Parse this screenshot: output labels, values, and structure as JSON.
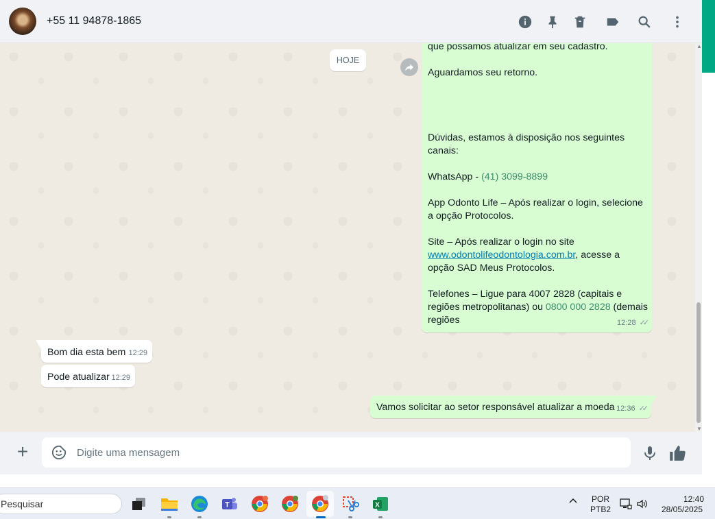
{
  "header": {
    "contact": "+55 11 94878-1865",
    "icons": [
      "info-icon",
      "pin-icon",
      "trash-icon",
      "label-icon",
      "search-icon",
      "menu-icon"
    ]
  },
  "chat": {
    "date_label": "HOJE",
    "big_message": {
      "lines": [
        "que possamos atualizar em seu cadastro.",
        "",
        "Aguardamos seu retorno.",
        "",
        "",
        "",
        "",
        "Dúvidas, estamos à disposição nos seguintes",
        "canais:",
        "",
        "WhatsApp - ",
        "",
        "App Odonto Life – Após realizar o login, selecione",
        "a opção Protocolos.",
        "",
        "Site – Após realizar o login no site",
        ", acesse a",
        "opção SAD Meus Protocolos.",
        "",
        "Telefones – Ligue para 4007 2828 (capitais e",
        "regiões metropolitanas) ou ",
        " (demais",
        "regiões"
      ],
      "whatsapp_number": "(41) 3099-8899",
      "site_link": "www.odontolifeodontologia.com.br",
      "phone_number": "0800 000 2828",
      "time": "12:28"
    },
    "incoming": [
      {
        "text": "Bom dia esta bem",
        "time": "12:29"
      },
      {
        "text": "Pode atualizar",
        "time": "12:29"
      }
    ],
    "outgoing_last": {
      "text": "Vamos solicitar ao setor responsável atualizar a moeda",
      "time": "12:36"
    }
  },
  "composer": {
    "placeholder": "Digite uma mensagem"
  },
  "taskbar": {
    "search_placeholder": "Pesquisar",
    "lang_top": "POR",
    "lang_bottom": "PTB2",
    "time": "12:40",
    "date": "28/05/2025"
  },
  "colors": {
    "accent": "#00a884",
    "outgoing_bubble": "#d9fdd3",
    "incoming_bubble": "#ffffff",
    "chat_bg": "#efeae2"
  }
}
